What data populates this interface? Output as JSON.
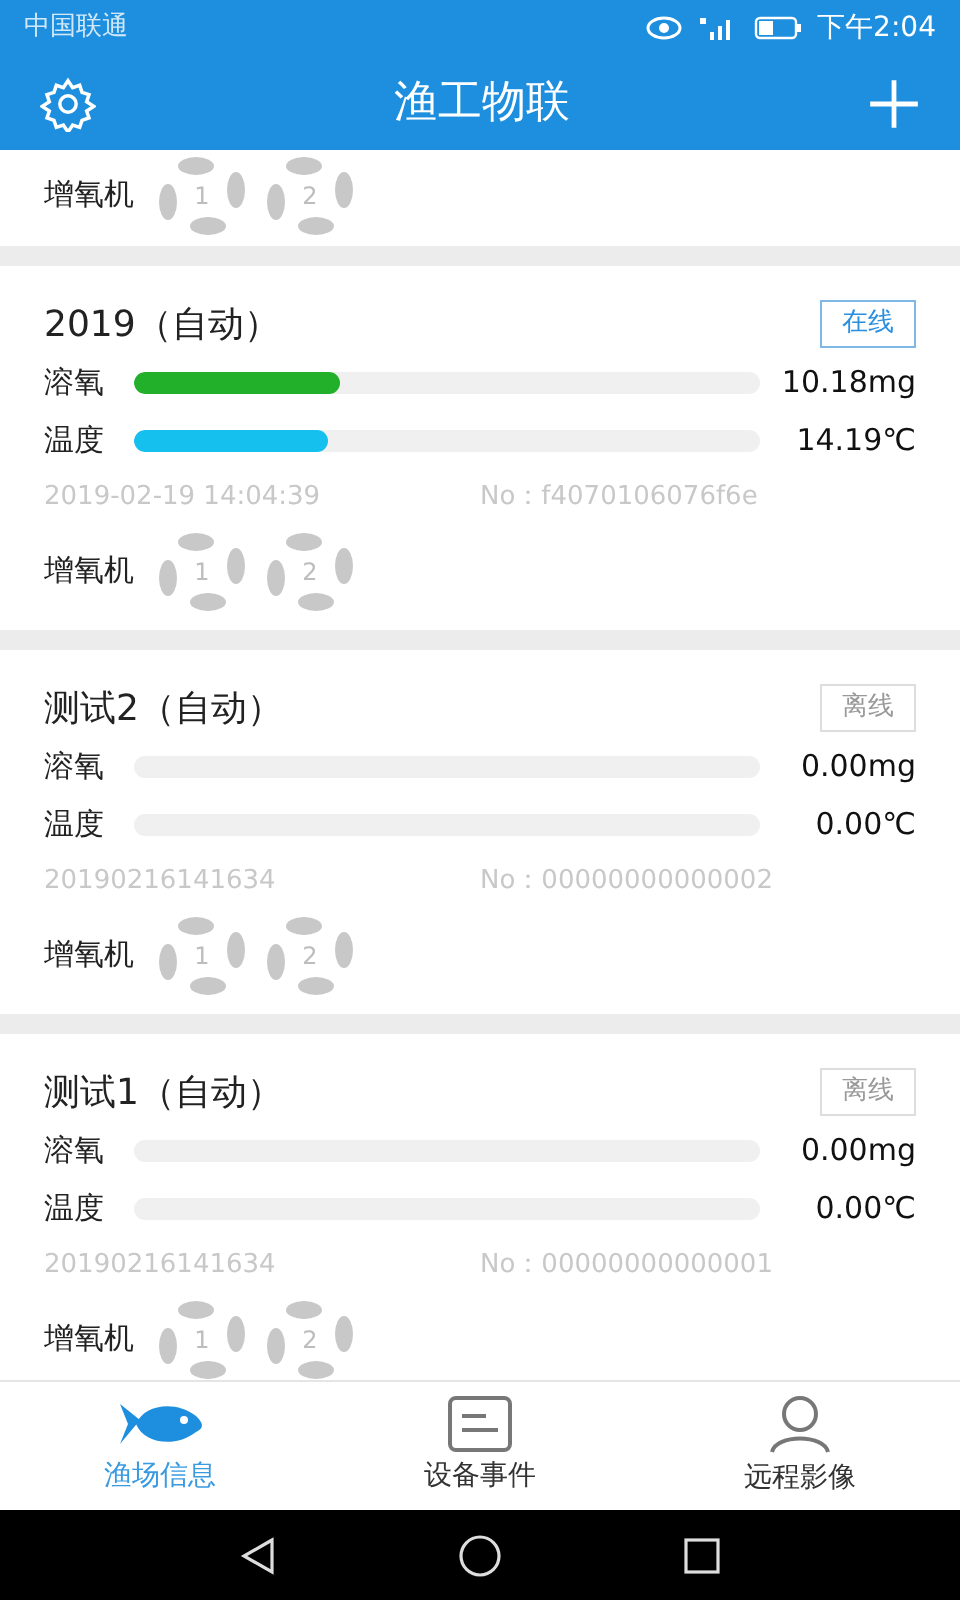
{
  "status_bar": {
    "carrier": "中国联通",
    "time": "下午2:04"
  },
  "header": {
    "title": "渔工物联"
  },
  "partial_card": {
    "aerator_label": "增氧机",
    "aerators": [
      {
        "number": "1",
        "on": false
      },
      {
        "number": "2",
        "on": false
      }
    ]
  },
  "devices": [
    {
      "title": "2019（自动）",
      "status": "在线",
      "online": true,
      "readings": [
        {
          "kind": "oxygen",
          "label": "溶氧",
          "level": 0.33,
          "value": "10.18mg"
        },
        {
          "kind": "temperature",
          "label": "温度",
          "level": 0.31,
          "value": "14.19℃"
        }
      ],
      "time": "2019-02-19 14:04:39",
      "serial": "No：f4070106076f6e",
      "aerator_label": "增氧机",
      "aerators": [
        {
          "number": "1",
          "on": false
        },
        {
          "number": "2",
          "on": false
        }
      ]
    },
    {
      "title": "测试2（自动）",
      "status": "离线",
      "online": false,
      "readings": [
        {
          "kind": "oxygen",
          "label": "溶氧",
          "level": 0,
          "value": "0.00mg"
        },
        {
          "kind": "temperature",
          "label": "温度",
          "level": 0,
          "value": "0.00℃"
        }
      ],
      "time": "20190216141634",
      "serial": "No：00000000000002",
      "aerator_label": "增氧机",
      "aerators": [
        {
          "number": "1",
          "on": false
        },
        {
          "number": "2",
          "on": false
        }
      ]
    },
    {
      "title": "测试1（自动）",
      "status": "离线",
      "online": false,
      "readings": [
        {
          "kind": "oxygen",
          "label": "溶氧",
          "level": 0,
          "value": "0.00mg"
        },
        {
          "kind": "temperature",
          "label": "温度",
          "level": 0,
          "value": "0.00℃"
        }
      ],
      "time": "20190216141634",
      "serial": "No：00000000000001",
      "aerator_label": "增氧机",
      "aerators": [
        {
          "number": "1",
          "on": false
        },
        {
          "number": "2",
          "on": false
        }
      ]
    }
  ],
  "tabs": [
    {
      "label": "渔场信息",
      "selected": true
    },
    {
      "label": "设备事件",
      "selected": false
    },
    {
      "label": "远程影像",
      "selected": false
    }
  ]
}
